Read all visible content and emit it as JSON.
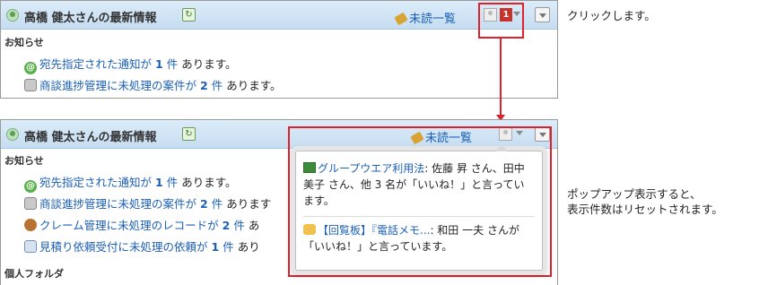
{
  "header": {
    "title": "高橋 健太さんの最新情報",
    "unread_link": "未読一覧",
    "badge_count": "1"
  },
  "section_notice": "お知らせ",
  "section_personal": "個人フォルダ",
  "top_rows": [
    {
      "link": "宛先指定された通知が",
      "count": "1",
      "unit": "件",
      "suffix": "あります。"
    },
    {
      "link": "商談進捗管理に未処理の案件が",
      "count": "2",
      "unit": "件",
      "suffix": "あります。"
    }
  ],
  "bottom_rows": [
    {
      "link": "宛先指定された通知が",
      "count": "1",
      "unit": "件",
      "suffix": "あります。"
    },
    {
      "link": "商談進捗管理に未処理の案件が",
      "count": "2",
      "unit": "件",
      "suffix": "あります"
    },
    {
      "link": "クレーム管理に未処理のレコードが",
      "count": "2",
      "unit": "件",
      "suffix": "あ"
    },
    {
      "link": "見積り依頼受付に未処理の依頼が",
      "count": "1",
      "unit": "件",
      "suffix": "あり"
    }
  ],
  "popup": {
    "items": [
      {
        "link": "グループウエア利用法",
        "text": ": 佐藤 昇 さん、田中 美子 さん、他 3 名が「いいね！」と言っています。"
      },
      {
        "link": "【回覧板】『電話メモ...",
        "text": ": 和田 一夫 さんが「いいね！」と言っています。"
      }
    ]
  },
  "callouts": {
    "click": "クリックします。",
    "reset_line1": "ポップアップ表示すると、",
    "reset_line2": "表示件数はリセットされます。"
  }
}
